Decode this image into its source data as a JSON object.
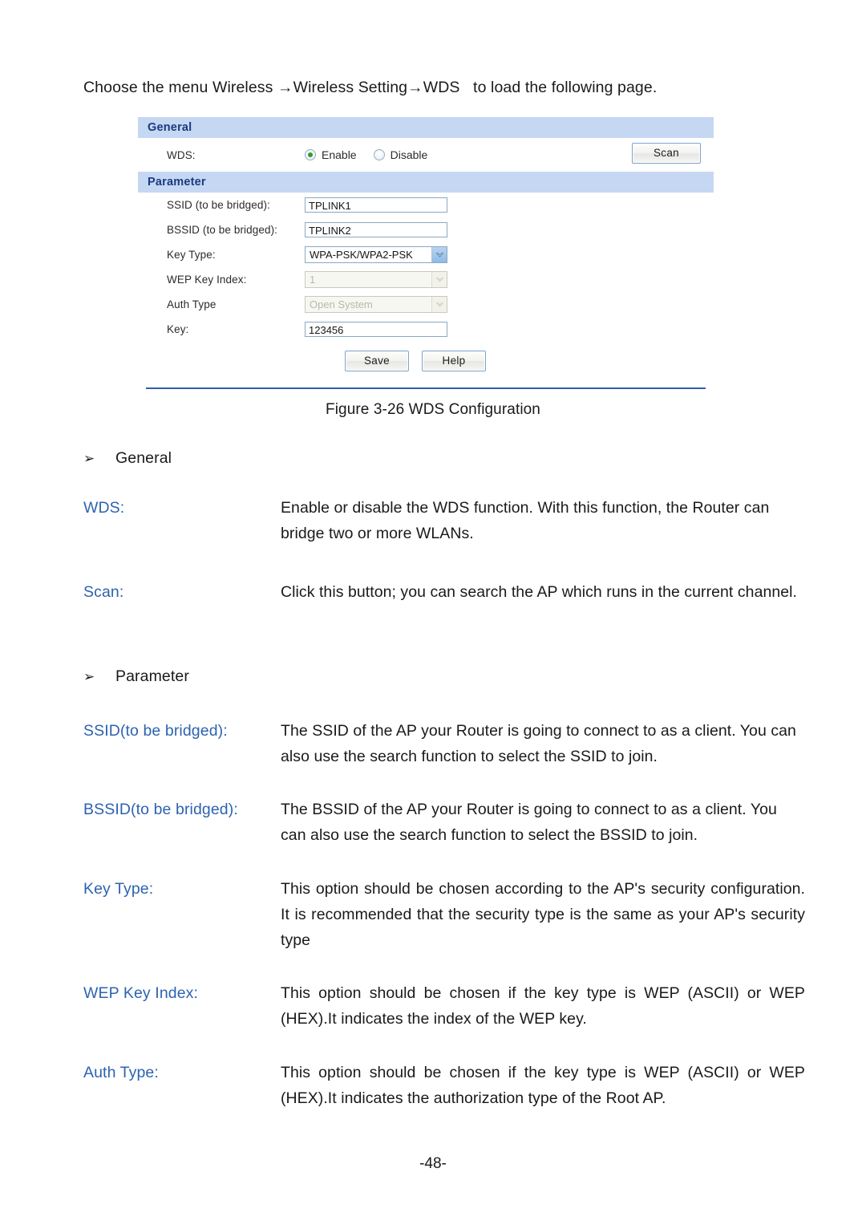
{
  "intro": {
    "text": "Choose the menu Wireless →Wireless Setting→WDS   to load the following page."
  },
  "router_panel": {
    "general": {
      "header": "General",
      "wds_label": "WDS:",
      "options": [
        {
          "label": "Enable",
          "selected": true
        },
        {
          "label": "Disable",
          "selected": false
        }
      ],
      "scan_button": "Scan"
    },
    "parameter": {
      "header": "Parameter",
      "fields": [
        {
          "label": "SSID (to be bridged):",
          "type": "text",
          "value": "TPLINK1",
          "disabled": false
        },
        {
          "label": "BSSID (to be bridged):",
          "type": "text",
          "value": "TPLINK2",
          "disabled": false
        },
        {
          "label": "Key Type:",
          "type": "select",
          "value": "WPA-PSK/WPA2-PSK",
          "disabled": false
        },
        {
          "label": "WEP Key Index:",
          "type": "select",
          "value": "1",
          "disabled": true
        },
        {
          "label": "Auth Type",
          "type": "select",
          "value": "Open System",
          "disabled": true
        },
        {
          "label": "Key:",
          "type": "text",
          "value": "123456",
          "disabled": false
        }
      ]
    },
    "buttons": {
      "save": "Save",
      "help": "Help"
    },
    "colors": {
      "header_bg": "#c5d7f2",
      "header_text": "#1b3a80",
      "rule": "#2f5fa8",
      "radio_dot": "#2e9e28",
      "select_arrow": "#8dbbe6"
    }
  },
  "figure": {
    "caption": "Figure 3-26 WDS Configuration"
  },
  "sections": [
    {
      "bullet": "➢",
      "title": "General"
    },
    {
      "bullet": "➢",
      "title": "Parameter"
    }
  ],
  "definitions": [
    {
      "term": "WDS:",
      "desc": "Enable or disable the WDS function. With this function, the Router can bridge two or more WLANs."
    },
    {
      "term": "Scan:",
      "desc": "Click this button; you can search the AP which runs in the current channel."
    },
    {
      "term": "SSID(to be bridged):",
      "desc": "The SSID of the AP your Router is going to connect to as a client. You can also use the search function to select the SSID to join."
    },
    {
      "term": "BSSID(to be bridged):",
      "desc": "The BSSID of the AP your Router is going to connect to as a client. You can also use the search function to select the BSSID to join."
    },
    {
      "term": "Key Type:",
      "desc": "This option should be chosen according to the AP's security configuration. It is recommended that the security type is the same as your AP's security type"
    },
    {
      "term": "WEP Key Index:",
      "desc": "This option should be chosen if the key type is WEP (ASCII) or WEP (HEX).It indicates the index of the WEP key."
    },
    {
      "term": "Auth Type:",
      "desc": "This option should be chosen if the key type is WEP (ASCII) or WEP (HEX).It indicates the authorization type of the Root AP."
    }
  ],
  "footer": {
    "page_number": "-48-"
  },
  "link_color": "#2d63b0"
}
